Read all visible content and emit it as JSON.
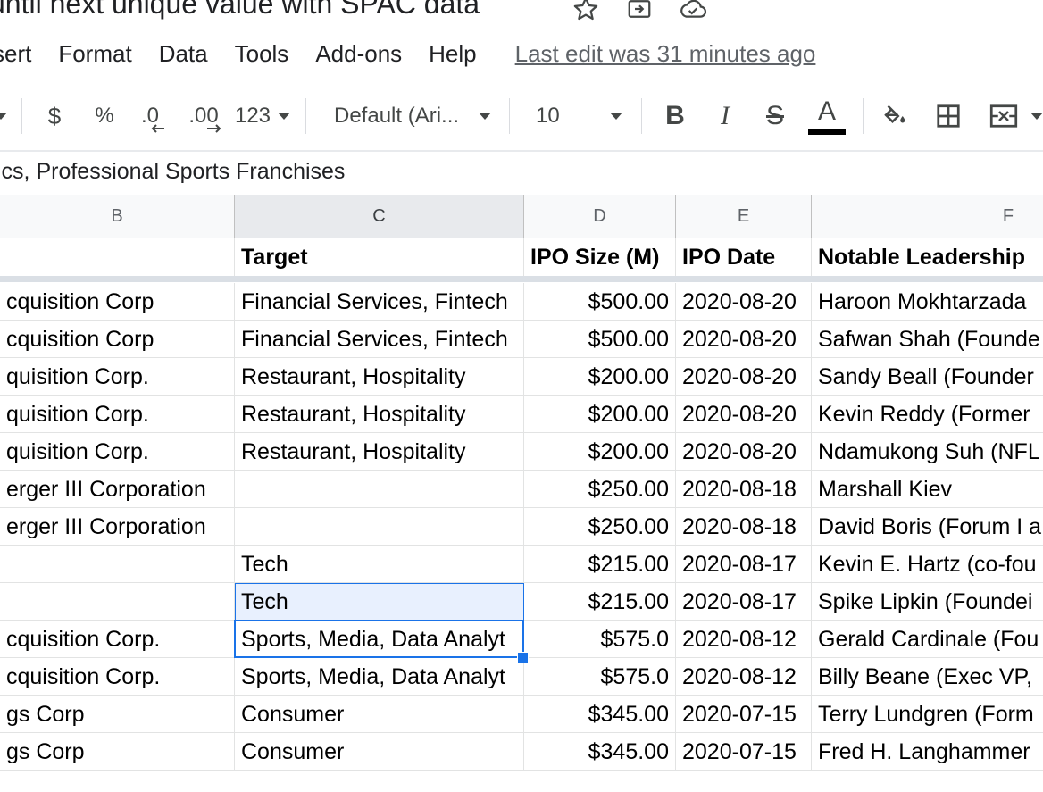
{
  "title": "until next unique value with SPAC data",
  "title_icons": [
    "star-icon",
    "move-to-folder-icon",
    "cloud-saved-icon"
  ],
  "menu": [
    "sert",
    "Format",
    "Data",
    "Tools",
    "Add-ons",
    "Help"
  ],
  "last_edit": "Last edit was 31 minutes ago",
  "toolbar": {
    "currency": "$",
    "percent": "%",
    "decrease_decimal": ".0",
    "increase_decimal": ".00",
    "number_format": "123",
    "font": "Default (Ari...",
    "font_size": "10",
    "bold": "B",
    "italic": "I",
    "strikethrough": "S",
    "text_color": "A",
    "text_color_bar": "#000000"
  },
  "formula_bar": {
    "value": "ics, Professional Sports Franchises"
  },
  "columns": [
    "B",
    "C",
    "D",
    "E",
    "F"
  ],
  "selected_column": "C",
  "header_row": {
    "b": "",
    "c": "Target",
    "d": "IPO Size (M)",
    "e": "IPO Date",
    "f": "Notable Leadership"
  },
  "rows": [
    {
      "b": "cquisition Corp",
      "c": "Financial Services, Fintech",
      "d": "$500.00",
      "e": "2020-08-20",
      "f": "Haroon Mokhtarzada"
    },
    {
      "b": "cquisition Corp",
      "c": "Financial Services, Fintech",
      "d": "$500.00",
      "e": "2020-08-20",
      "f": "Safwan Shah (Founde"
    },
    {
      "b": "quisition Corp.",
      "c": "Restaurant, Hospitality",
      "d": "$200.00",
      "e": "2020-08-20",
      "f": "Sandy Beall (Founder"
    },
    {
      "b": "quisition Corp.",
      "c": "Restaurant, Hospitality",
      "d": "$200.00",
      "e": "2020-08-20",
      "f": "Kevin Reddy (Former"
    },
    {
      "b": "quisition Corp.",
      "c": "Restaurant, Hospitality",
      "d": "$200.00",
      "e": "2020-08-20",
      "f": "Ndamukong Suh (NFL"
    },
    {
      "b": "erger III Corporation",
      "c": "",
      "d": "$250.00",
      "e": "2020-08-18",
      "f": "Marshall Kiev"
    },
    {
      "b": "erger III Corporation",
      "c": "",
      "d": "$250.00",
      "e": "2020-08-18",
      "f": "David Boris (Forum I a"
    },
    {
      "b": "",
      "c": "Tech",
      "d": "$215.00",
      "e": "2020-08-17",
      "f": "Kevin E. Hartz (co-fou"
    },
    {
      "b": "",
      "c": "Tech",
      "d": "$215.00",
      "e": "2020-08-17",
      "f": "Spike Lipkin (Foundei"
    },
    {
      "b": "cquisition Corp.",
      "c": "Sports, Media, Data Analyt",
      "d": "$575.0",
      "e": "2020-08-12",
      "f": "Gerald Cardinale (Fou"
    },
    {
      "b": "cquisition Corp.",
      "c": "Sports, Media, Data Analyt",
      "d": "$575.0",
      "e": "2020-08-12",
      "f": "Billy Beane (Exec VP,"
    },
    {
      "b": "gs Corp",
      "c": "Consumer",
      "d": "$345.00",
      "e": "2020-07-15",
      "f": "Terry Lundgren (Form"
    },
    {
      "b": "gs Corp",
      "c": "Consumer",
      "d": "$345.00",
      "e": "2020-07-15",
      "f": "Fred H. Langhammer"
    }
  ],
  "colors": {
    "selection": "#1a73e8",
    "highlight": "#e8f0fe"
  }
}
